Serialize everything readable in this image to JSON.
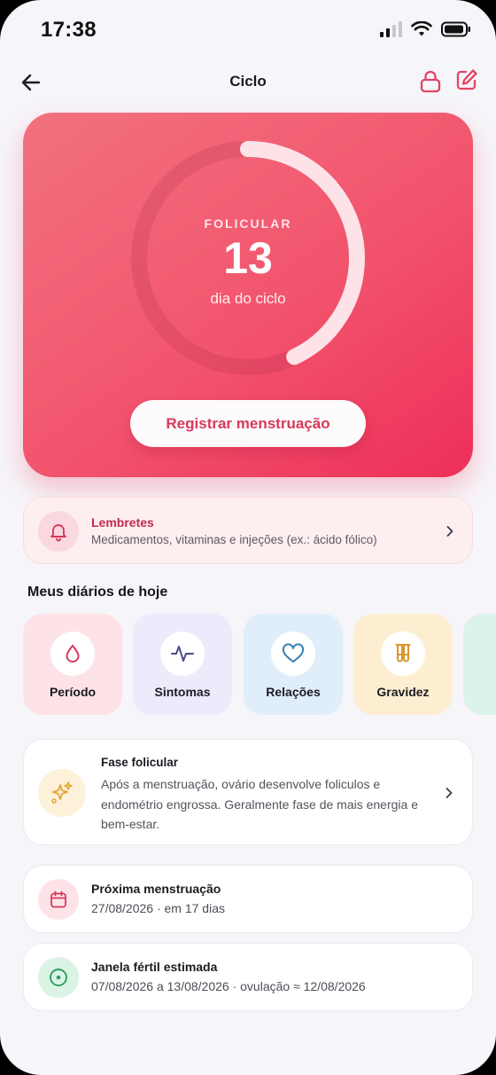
{
  "status_bar": {
    "time": "17:38"
  },
  "header": {
    "title": "Ciclo",
    "back_icon": "arrow-left-icon",
    "lock_icon": "lock-icon",
    "edit_icon": "edit-icon"
  },
  "hero": {
    "phase": "FOLICULAR",
    "day": "13",
    "caption": "dia do ciclo",
    "progress_fraction": 0.43,
    "register_label": "Registrar menstruação",
    "colors": {
      "accent": "#ef4a68",
      "button_text": "#d63a5b"
    }
  },
  "reminders": {
    "title": "Lembretes",
    "subtitle": "Medicamentos, vitaminas e injeções (ex.: ácido fólico)",
    "icon": "bell-icon"
  },
  "diaries": {
    "section_title": "Meus diários de hoje",
    "items": [
      {
        "label": "Período",
        "icon": "drop-icon",
        "bg": "#fde3e7",
        "color": "#d63a5b"
      },
      {
        "label": "Sintomas",
        "icon": "pulse-icon",
        "bg": "#ecebfc",
        "color": "#4a4a8a"
      },
      {
        "label": "Relações",
        "icon": "heart-icon",
        "bg": "#dfeefa",
        "color": "#3a7fb3"
      },
      {
        "label": "Gravidez",
        "icon": "test-tubes-icon",
        "bg": "#fdeed1",
        "color": "#d9962a"
      }
    ]
  },
  "phase_card": {
    "title": "Fase folicular",
    "text": "Após a menstruação, ovário desenvolve foliculos e endométrio engrossa. Geralmente fase de mais energia e bem-estar.",
    "icon": "sparkles-icon"
  },
  "next_period": {
    "title": "Próxima menstruação",
    "subtitle": "27/08/2026 · em 17 dias",
    "icon": "calendar-icon"
  },
  "fertile_window": {
    "title": "Janela fértil estimada",
    "subtitle": "07/08/2026 a 13/08/2026 · ovulação ≈ 12/08/2026",
    "icon": "target-icon"
  }
}
